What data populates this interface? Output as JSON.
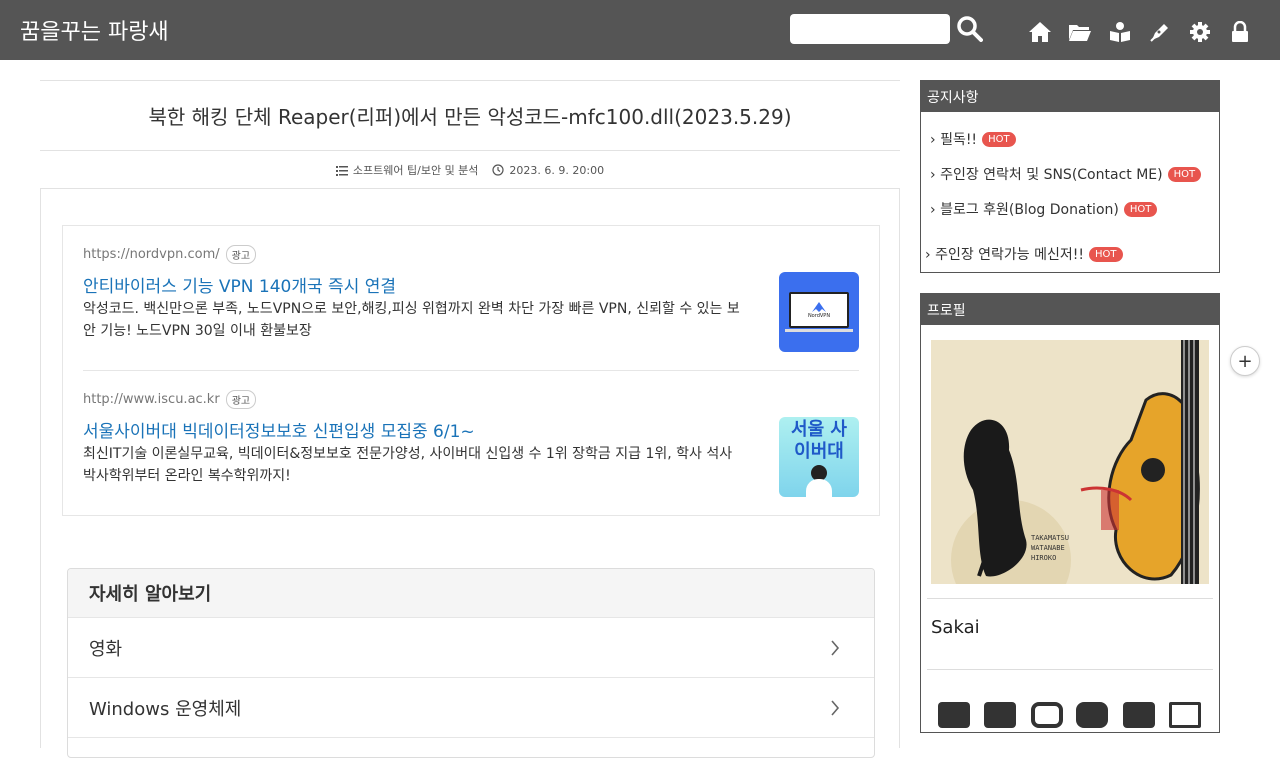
{
  "header": {
    "blog_title": "꿈을꾸는 파랑새",
    "search_placeholder": "",
    "icons": [
      "home-icon",
      "folder-icon",
      "guestbook-icon",
      "write-icon",
      "settings-icon",
      "lock-icon"
    ]
  },
  "post": {
    "title": "북한 해킹 단체 Reaper(리퍼)에서 만든 악성코드-mfc100.dll(2023.5.29)",
    "category": "소프트웨어 팁/보안 및 분석",
    "date": "2023. 6. 9. 20:00"
  },
  "ads": [
    {
      "url": "https://nordvpn.com/",
      "badge": "광고",
      "headline": "안티바이러스 기능 VPN 140개국 즉시 연결",
      "description": "악성코드. 백신만으론 부족, 노드VPN으로 보안,해킹,피싱 위협까지 완벽 차단 가장 빠른 VPN, 신뢰할 수 있는 보안 기능! 노드VPN 30일 이내 환불보장",
      "image_label": "NordVPN"
    },
    {
      "url": "http://www.iscu.ac.kr",
      "badge": "광고",
      "headline": "서울사이버대 빅데이터정보보호 신편입생 모집중 6/1~",
      "description": "최신IT기술 이론실무교육, 빅데이터&정보보호 전문가양성, 사이버대 신입생 수 1위 장학금 지급 1위, 학사 석사 박사학위부터 온라인 복수학위까지!",
      "image_label": "서울 사이버대"
    }
  ],
  "more": {
    "heading": "자세히 알아보기",
    "rows": [
      "영화",
      "Windows 운영체제"
    ]
  },
  "sidebar": {
    "notice_title": "공지사항",
    "notices": [
      {
        "label": "필독!!",
        "badge": "HOT"
      },
      {
        "label": "주인장 연락처 및 SNS(Contact ME)",
        "badge": "HOT"
      },
      {
        "label": "블로그 후원(Blog Donation)",
        "badge": "HOT"
      },
      {
        "label": "주인장 연락가능 메신저!!",
        "badge": "HOT"
      }
    ],
    "profile_title": "프로필",
    "profile_name": "Sakai"
  },
  "colors": {
    "header_bg": "#555555",
    "link": "#1a73b8",
    "hot": "#e8554e"
  }
}
